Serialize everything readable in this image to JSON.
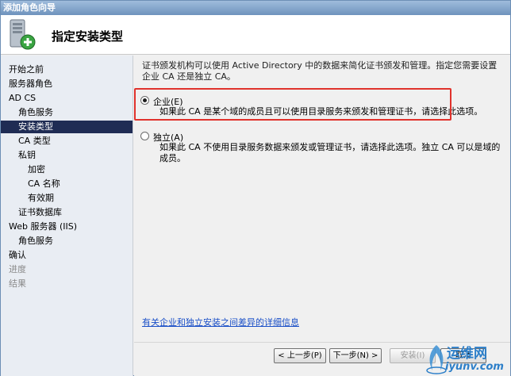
{
  "window": {
    "title": "添加角色向导"
  },
  "header": {
    "title": "指定安装类型",
    "icon": "server-add-icon"
  },
  "sidebar": {
    "items": [
      {
        "label": "开始之前",
        "state": "normal"
      },
      {
        "label": "服务器角色",
        "state": "normal"
      },
      {
        "label": "AD CS",
        "state": "normal"
      },
      {
        "label": "角色服务",
        "state": "normal"
      },
      {
        "label": "安装类型",
        "state": "selected"
      },
      {
        "label": "CA 类型",
        "state": "normal"
      },
      {
        "label": "私钥",
        "state": "normal"
      },
      {
        "label": "加密",
        "state": "normal"
      },
      {
        "label": "CA 名称",
        "state": "normal"
      },
      {
        "label": "有效期",
        "state": "normal"
      },
      {
        "label": "证书数据库",
        "state": "normal"
      },
      {
        "label": "Web 服务器 (IIS)",
        "state": "normal"
      },
      {
        "label": "角色服务",
        "state": "normal"
      },
      {
        "label": "确认",
        "state": "normal"
      },
      {
        "label": "进度",
        "state": "disabled"
      },
      {
        "label": "结果",
        "state": "disabled"
      }
    ]
  },
  "main": {
    "description": "证书颁发机构可以使用 Active Directory 中的数据来简化证书颁发和管理。指定您需要设置企业 CA 还是独立 CA。",
    "options": [
      {
        "label": "企业(E)",
        "checked": true,
        "description": "如果此 CA 是某个域的成员且可以使用目录服务来颁发和管理证书，请选择此选项。"
      },
      {
        "label": "独立(A)",
        "checked": false,
        "description": "如果此 CA 不使用目录服务数据来颁发或管理证书，请选择此选项。独立 CA 可以是域的成员。"
      }
    ],
    "details_link": "有关企业和独立安装之间差异的详细信息"
  },
  "footer": {
    "back_label": "< 上一步(P)",
    "next_label": "下一步(N) >",
    "install_label": "安装(I)",
    "cancel_label": "取消"
  },
  "watermark": {
    "logo_text": "运维网",
    "url": "iyunv.com"
  },
  "colors": {
    "selected_bg": "#1f2c54",
    "highlight": "#e0322c",
    "link": "#1a4fc7"
  }
}
